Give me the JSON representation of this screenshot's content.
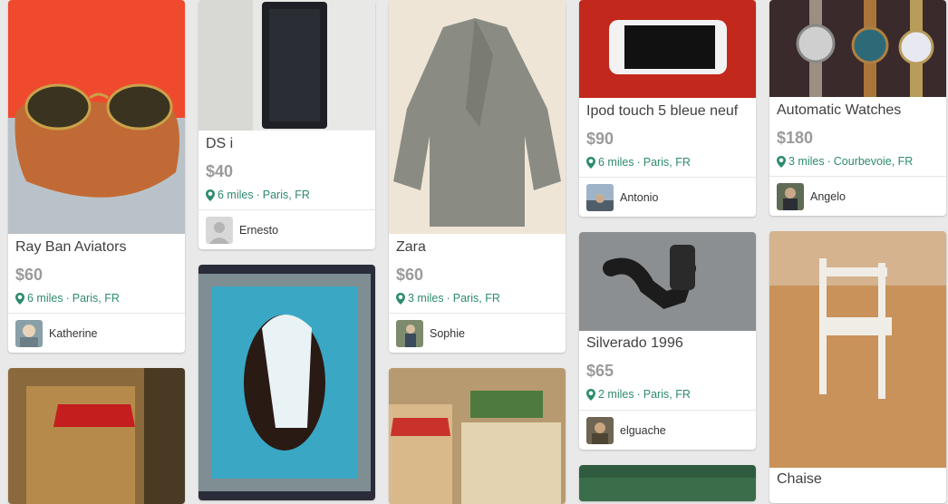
{
  "listings": [
    {
      "title": "Ray Ban Aviators",
      "price": "$60",
      "distance": "6 miles",
      "location": "Paris, FR",
      "seller": "Katherine",
      "photo_icon": "sunglasses-photo"
    },
    {
      "title": "DS i",
      "price": "$40",
      "distance": "6 miles",
      "location": "Paris, FR",
      "seller": "Ernesto",
      "photo_icon": "nintendo-ds-photo"
    },
    {
      "title": "Zara",
      "price": "$60",
      "distance": "3 miles",
      "location": "Paris, FR",
      "seller": "Sophie",
      "photo_icon": "coat-photo"
    },
    {
      "title": "Ipod touch 5 bleue neuf",
      "price": "$90",
      "distance": "6 miles",
      "location": "Paris, FR",
      "seller": "Antonio",
      "photo_icon": "ipod-photo"
    },
    {
      "title": "Automatic Watches",
      "price": "$180",
      "distance": "3 miles",
      "location": "Courbevoie, FR",
      "seller": "Angelo",
      "photo_icon": "watches-photo"
    },
    {
      "title": "Silverado 1996",
      "price": "$65",
      "distance": "2 miles",
      "location": "Paris, FR",
      "seller": "elguache",
      "photo_icon": "air-intake-photo"
    },
    {
      "title": "Chaise",
      "photo_icon": "chair-photo"
    },
    {
      "photo_icon": "painting-woman-photo"
    },
    {
      "photo_icon": "painting-street-photo"
    },
    {
      "photo_icon": "painting-cafe-photo"
    },
    {
      "photo_icon": "storefront-photo"
    }
  ],
  "separator": " · ",
  "colors": {
    "location": "#2e8b6f",
    "price": "#9a9a9a",
    "background": "#e9e9e9"
  }
}
